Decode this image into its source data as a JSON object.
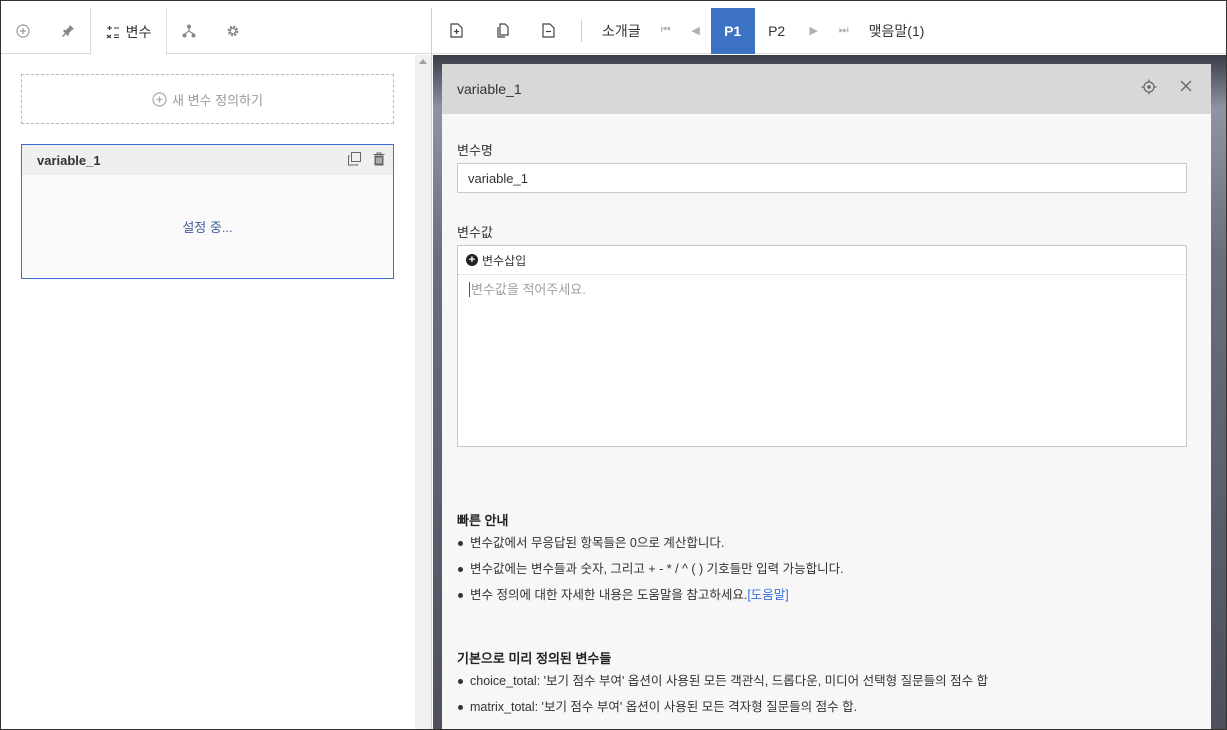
{
  "left_tabs": {
    "tab_add": "add-circle-icon",
    "tab_pin": "pin-icon",
    "tab_variables_label": "변수",
    "tab_branch": "branch-icon",
    "tab_settings": "gear-icon"
  },
  "left": {
    "new_variable_label": "새 변수 정의하기",
    "variable_card": {
      "name": "variable_1",
      "status": "설정 중..."
    }
  },
  "toolbar": {
    "intro_label": "소개글",
    "pages": [
      "P1",
      "P2"
    ],
    "active_page": "P1",
    "closing_label": "맺음말(1)",
    "accent": "#3b72c4"
  },
  "panel": {
    "title": "variable_1",
    "name_label": "변수명",
    "name_value": "variable_1",
    "value_label": "변수값",
    "insert_variable_label": "변수삽입",
    "value_placeholder": "변수값을 적어주세요.",
    "quick_guide_title": "빠른 안내",
    "quick_guide_items": [
      "변수값에서 무응답된 항목들은 0으로 계산합니다.",
      "변수값에는 변수들과 숫자, 그리고 + - * / ^ ( ) 기호들만 입력 가능합니다.",
      "변수 정의에 대한 자세한 내용은 도움말을 참고하세요."
    ],
    "help_link_label": "[도움말]",
    "predefined_title": "기본으로 미리 정의된 변수들",
    "predefined_items": [
      "choice_total: '보기 점수 부여' 옵션이 사용된 모든 객관식, 드롭다운, 미디어 선택형 질문들의 점수 합",
      "matrix_total: '보기 점수 부여' 옵션이 사용된 모든 격자형 질문들의 점수 합."
    ]
  }
}
